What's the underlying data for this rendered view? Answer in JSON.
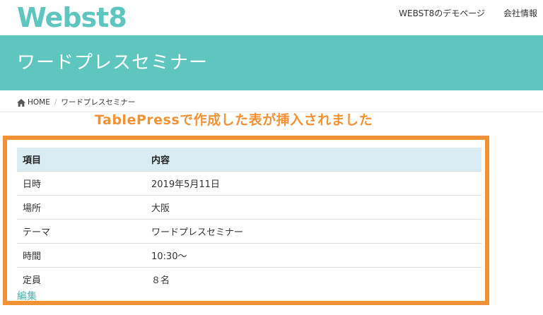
{
  "header": {
    "logo_text": "Webst8",
    "nav": [
      "WEBST8のデモページ",
      "会社情報"
    ]
  },
  "page_title": "ワードプレスセミナー",
  "breadcrumb": {
    "home_label": "HOME",
    "separator": "/",
    "current": "ワードプレスセミナー"
  },
  "annotation": "TablePressで作成した表が挿入されました",
  "table": {
    "headers": [
      "項目",
      "内容"
    ],
    "rows": [
      [
        "日時",
        "2019年5月11日"
      ],
      [
        "場所",
        "大阪"
      ],
      [
        "テーマ",
        "ワードプレスセミナー"
      ],
      [
        "時間",
        "10:30～"
      ],
      [
        "定員",
        "８名"
      ]
    ]
  },
  "edit_link": "編集",
  "colors": {
    "brand": "#5ec5bf",
    "annotation": "#f29236",
    "table_header": "#d9ebf3"
  }
}
